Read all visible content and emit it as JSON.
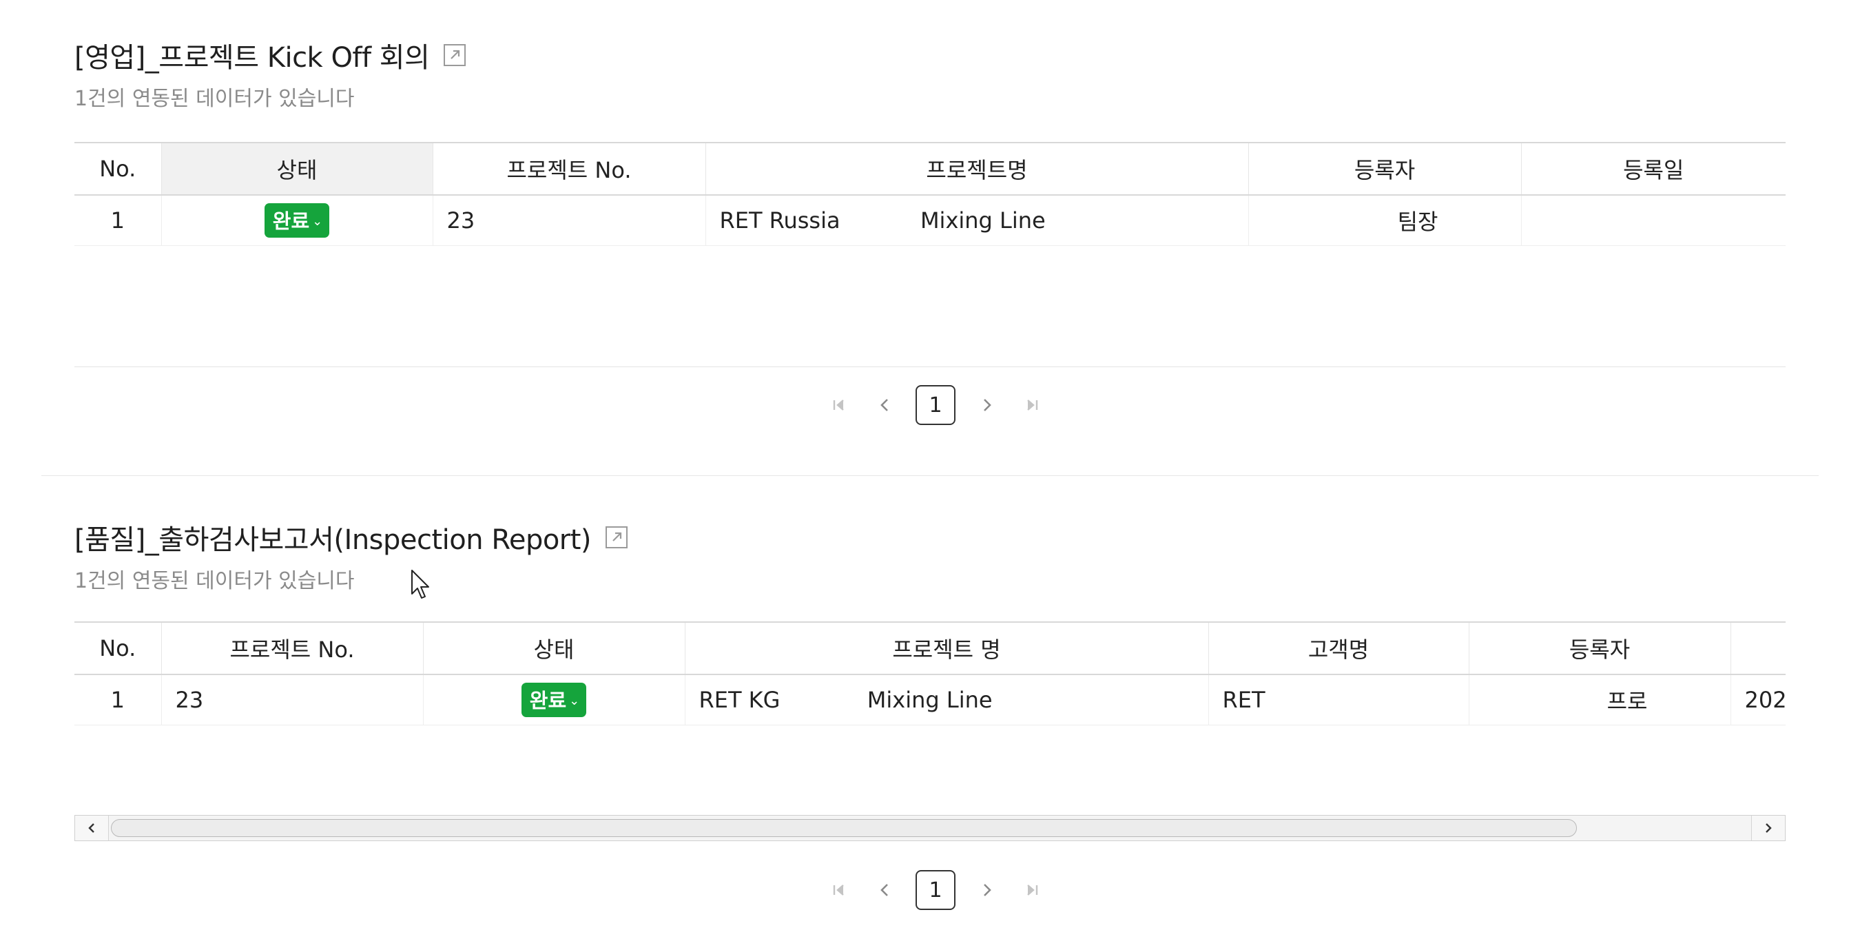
{
  "section1": {
    "title": "[영업]_프로젝트 Kick Off 회의",
    "subtitle": "1건의 연동된 데이터가 있습니다",
    "columns": [
      "No.",
      "상태",
      "프로젝트 No.",
      "프로젝트명",
      "등록자",
      "등록일"
    ],
    "rows": [
      {
        "no": "1",
        "status": "완료",
        "project_no": "23",
        "project_name_a": "RET Russia",
        "project_name_b": "Mixing Line",
        "registrant": "팀장",
        "reg_date": ""
      }
    ],
    "pager": {
      "current_page": "1"
    }
  },
  "section2": {
    "title": "[품질]_출하검사보고서(Inspection Report)",
    "subtitle": "1건의 연동된 데이터가 있습니다",
    "columns": [
      "No.",
      "프로젝트 No.",
      "상태",
      "프로젝트 명",
      "고객명",
      "등록자",
      ""
    ],
    "rows": [
      {
        "no": "1",
        "project_no": "23",
        "status": "완료",
        "project_name_a": "RET KG",
        "project_name_b": "Mixing Line",
        "customer": "RET",
        "registrant": "프로",
        "reg_date": "202"
      }
    ],
    "pager": {
      "current_page": "1"
    }
  },
  "colors": {
    "status_green": "#15a43c",
    "header_shade": "#f1f1f1",
    "subtitle_gray": "#8a8a8a"
  },
  "icons": {
    "external": "external-link-icon",
    "first": "first-page-icon",
    "prev": "prev-page-icon",
    "next": "next-page-icon",
    "last": "last-page-icon"
  }
}
